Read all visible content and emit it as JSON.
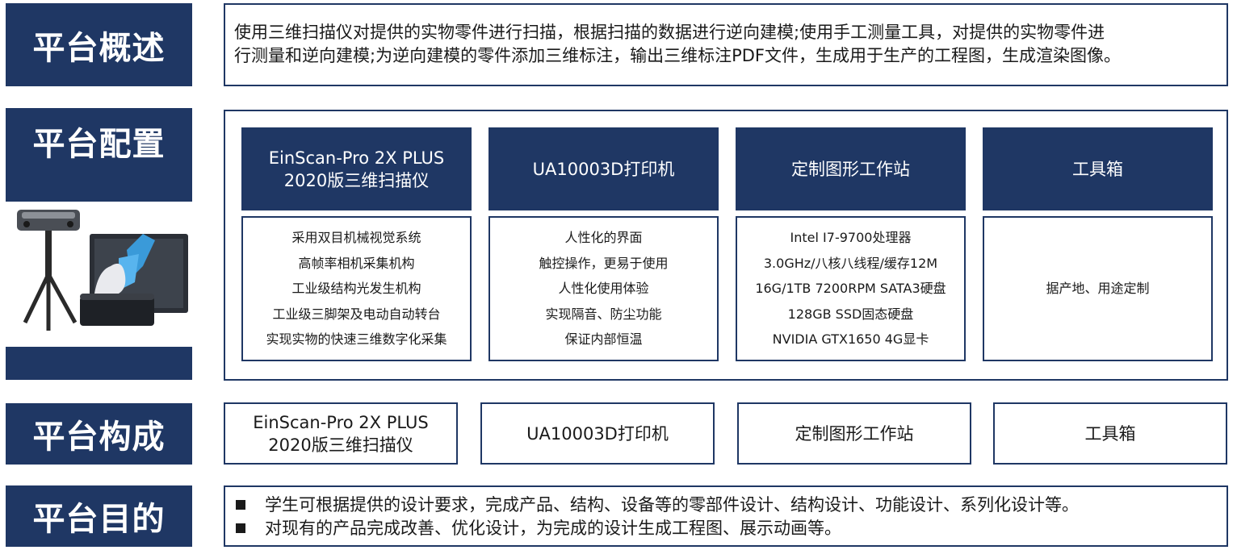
{
  "sections": {
    "overview": "平台概述",
    "config": "平台配置",
    "composition": "平台构成",
    "purpose": "平台目的"
  },
  "overview": {
    "line1": "使用三维扫描仪对提供的实物零件进行扫描，根据扫描的数据进行逆向建模;使用手工测量工具，对提供的实物零件进",
    "line2": "行测量和逆向建模;为逆向建模的零件添加三维标注，输出三维标注PDF文件，生成用于生产的工程图，生成渲染图像。"
  },
  "config": {
    "columns": [
      {
        "title_line1": "EinScan-Pro 2X PLUS",
        "title_line2": "2020版三维扫描仪",
        "specs": [
          "采用双目机械视觉系统",
          "高帧率相机采集机构",
          "工业级结构光发生机构",
          "工业级三脚架及电动自动转台",
          "实现实物的快速三维数字化采集"
        ]
      },
      {
        "title_line1": "UA10003D打印机",
        "title_line2": "",
        "specs": [
          "人性化的界面",
          "触控操作，更易于使用",
          "人性化使用体验",
          "实现隔音、防尘功能",
          "保证内部恒温"
        ]
      },
      {
        "title_line1": "定制图形工作站",
        "title_line2": "",
        "specs": [
          "Intel I7-9700处理器",
          "3.0GHz/八核八线程/缓存12M",
          "16G/1TB 7200RPM SATA3硬盘",
          "128GB SSD固态硬盘",
          "NVIDIA GTX1650 4G显卡"
        ]
      },
      {
        "title_line1": "工具箱",
        "title_line2": "",
        "specs": [
          "据产地、用途定制"
        ]
      }
    ]
  },
  "composition": {
    "items": [
      {
        "line1": "EinScan-Pro 2X PLUS",
        "line2": "2020版三维扫描仪"
      },
      {
        "line1": "UA10003D打印机",
        "line2": ""
      },
      {
        "line1": "定制图形工作站",
        "line2": ""
      },
      {
        "line1": "工具箱",
        "line2": ""
      }
    ]
  },
  "purpose": {
    "items": [
      "学生可根据提供的设计要求，完成产品、结构、设备等的零部件设计、结构设计、功能设计、系列化设计等。",
      "对现有的产品完成改善、优化设计，为完成的设计生成工程图、展示动画等。"
    ]
  },
  "colors": {
    "navy": "#1f3764",
    "accent": "#3a9ad9"
  }
}
